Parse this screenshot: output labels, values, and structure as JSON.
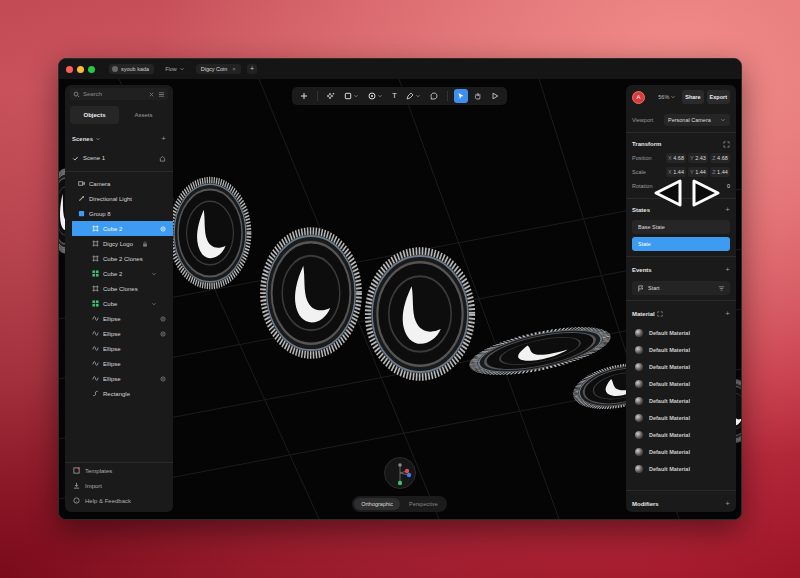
{
  "titlebar": {
    "workspace": "syoub kada",
    "tabs": [
      {
        "label": "Flow",
        "selected": false,
        "kind": "menu"
      },
      {
        "label": "Digcy Coin",
        "selected": true,
        "kind": "file",
        "close": "×"
      }
    ],
    "new_tab": "+"
  },
  "toolbar": [
    {
      "kind": "add",
      "selected": false,
      "dropdown": false
    },
    {
      "kind": "ai",
      "selected": false,
      "dropdown": false
    },
    {
      "kind": "rectangle",
      "selected": false,
      "dropdown": true
    },
    {
      "kind": "ellipse",
      "selected": false,
      "dropdown": true
    },
    {
      "kind": "text",
      "glyph": "T",
      "selected": false,
      "dropdown": false
    },
    {
      "kind": "pen",
      "selected": false,
      "dropdown": true
    },
    {
      "kind": "comment",
      "selected": false,
      "dropdown": false
    },
    {
      "kind": "select",
      "selected": true,
      "dropdown": false
    },
    {
      "kind": "hand",
      "selected": false,
      "dropdown": false
    },
    {
      "kind": "play",
      "selected": false,
      "dropdown": false
    }
  ],
  "sidebar": {
    "search": {
      "placeholder": "Search"
    },
    "tabs": [
      {
        "label": "Objects",
        "selected": true
      },
      {
        "label": "Assets",
        "selected": false
      }
    ],
    "scenes": {
      "title": "Scenes",
      "add": "+",
      "items": [
        {
          "label": "Scene 1",
          "selected": true
        }
      ]
    },
    "objects": [
      {
        "label": "Camera",
        "kind": "camera",
        "depth": 0,
        "selected": false,
        "marker": "none"
      },
      {
        "label": "Directional Light",
        "kind": "light",
        "depth": 0,
        "selected": false,
        "marker": "none"
      },
      {
        "label": "Group 8",
        "kind": "group",
        "depth": 0,
        "selected": false,
        "marker": "none"
      },
      {
        "label": "Cube 2",
        "kind": "component",
        "depth": 1,
        "selected": true,
        "marker": "target"
      },
      {
        "label": "Digcy Logo",
        "kind": "instance",
        "depth": 2,
        "selected": false,
        "marker": "lock"
      },
      {
        "label": "Cube 2 Clones",
        "kind": "instance",
        "depth": 2,
        "selected": false,
        "marker": "none"
      },
      {
        "label": "Cube 2",
        "kind": "grid",
        "depth": 2,
        "selected": false,
        "marker": "collapse"
      },
      {
        "label": "Cube Clones",
        "kind": "instance",
        "depth": 2,
        "selected": false,
        "marker": "none"
      },
      {
        "label": "Cube",
        "kind": "grid",
        "depth": 2,
        "selected": false,
        "marker": "collapse"
      },
      {
        "label": "Ellipse",
        "kind": "ellipse",
        "depth": 2,
        "selected": false,
        "marker": "target"
      },
      {
        "label": "Ellipse",
        "kind": "ellipse",
        "depth": 2,
        "selected": false,
        "marker": "target"
      },
      {
        "label": "Ellipse",
        "kind": "ellipse",
        "depth": 2,
        "selected": false,
        "marker": "none"
      },
      {
        "label": "Ellipse",
        "kind": "ellipse",
        "depth": 2,
        "selected": false,
        "marker": "none"
      },
      {
        "label": "Ellipse",
        "kind": "ellipse",
        "depth": 2,
        "selected": false,
        "marker": "target"
      },
      {
        "label": "Rectangle",
        "kind": "rectangle",
        "depth": 2,
        "selected": false,
        "marker": "none"
      }
    ],
    "footer": [
      {
        "label": "Templates",
        "kind": "templates"
      },
      {
        "label": "Import",
        "kind": "import"
      },
      {
        "label": "Help & Feedback",
        "kind": "help"
      }
    ]
  },
  "canvas": {
    "projection": [
      {
        "label": "Orthographic",
        "selected": true
      },
      {
        "label": "Perspective",
        "selected": false
      }
    ]
  },
  "inspector": {
    "avatar": "A",
    "zoom": "56%",
    "share": "Share",
    "export": "Export",
    "viewport": {
      "label": "Viewport",
      "value": "Personal Camera"
    },
    "transform": {
      "title": "Transform",
      "rows": [
        {
          "label": "Position",
          "values": [
            {
              "axis": "X",
              "value": "4.68"
            },
            {
              "axis": "Y",
              "value": "2.43"
            },
            {
              "axis": "Z",
              "value": "4.68"
            }
          ]
        },
        {
          "label": "Scale",
          "values": [
            {
              "axis": "X",
              "value": "1.44"
            },
            {
              "axis": "Y",
              "value": "1.44"
            },
            {
              "axis": "Z",
              "value": "1.44"
            }
          ]
        }
      ],
      "rotation": {
        "label": "Rotation",
        "value": "0"
      }
    },
    "states": {
      "title": "States",
      "add": "+",
      "items": [
        {
          "label": "Base State",
          "selected": false
        },
        {
          "label": "State",
          "selected": true
        }
      ]
    },
    "events": {
      "title": "Events",
      "add": "+",
      "items": [
        {
          "label": "Start"
        }
      ]
    },
    "material": {
      "title": "Material",
      "add": "+",
      "items": [
        {
          "label": "Default Material"
        },
        {
          "label": "Default Material"
        },
        {
          "label": "Default Material"
        },
        {
          "label": "Default Material"
        },
        {
          "label": "Default Material"
        },
        {
          "label": "Default Material"
        },
        {
          "label": "Default Material"
        },
        {
          "label": "Default Material"
        },
        {
          "label": "Default Material"
        }
      ]
    },
    "modifiers": {
      "title": "Modifiers",
      "add": "+"
    }
  }
}
